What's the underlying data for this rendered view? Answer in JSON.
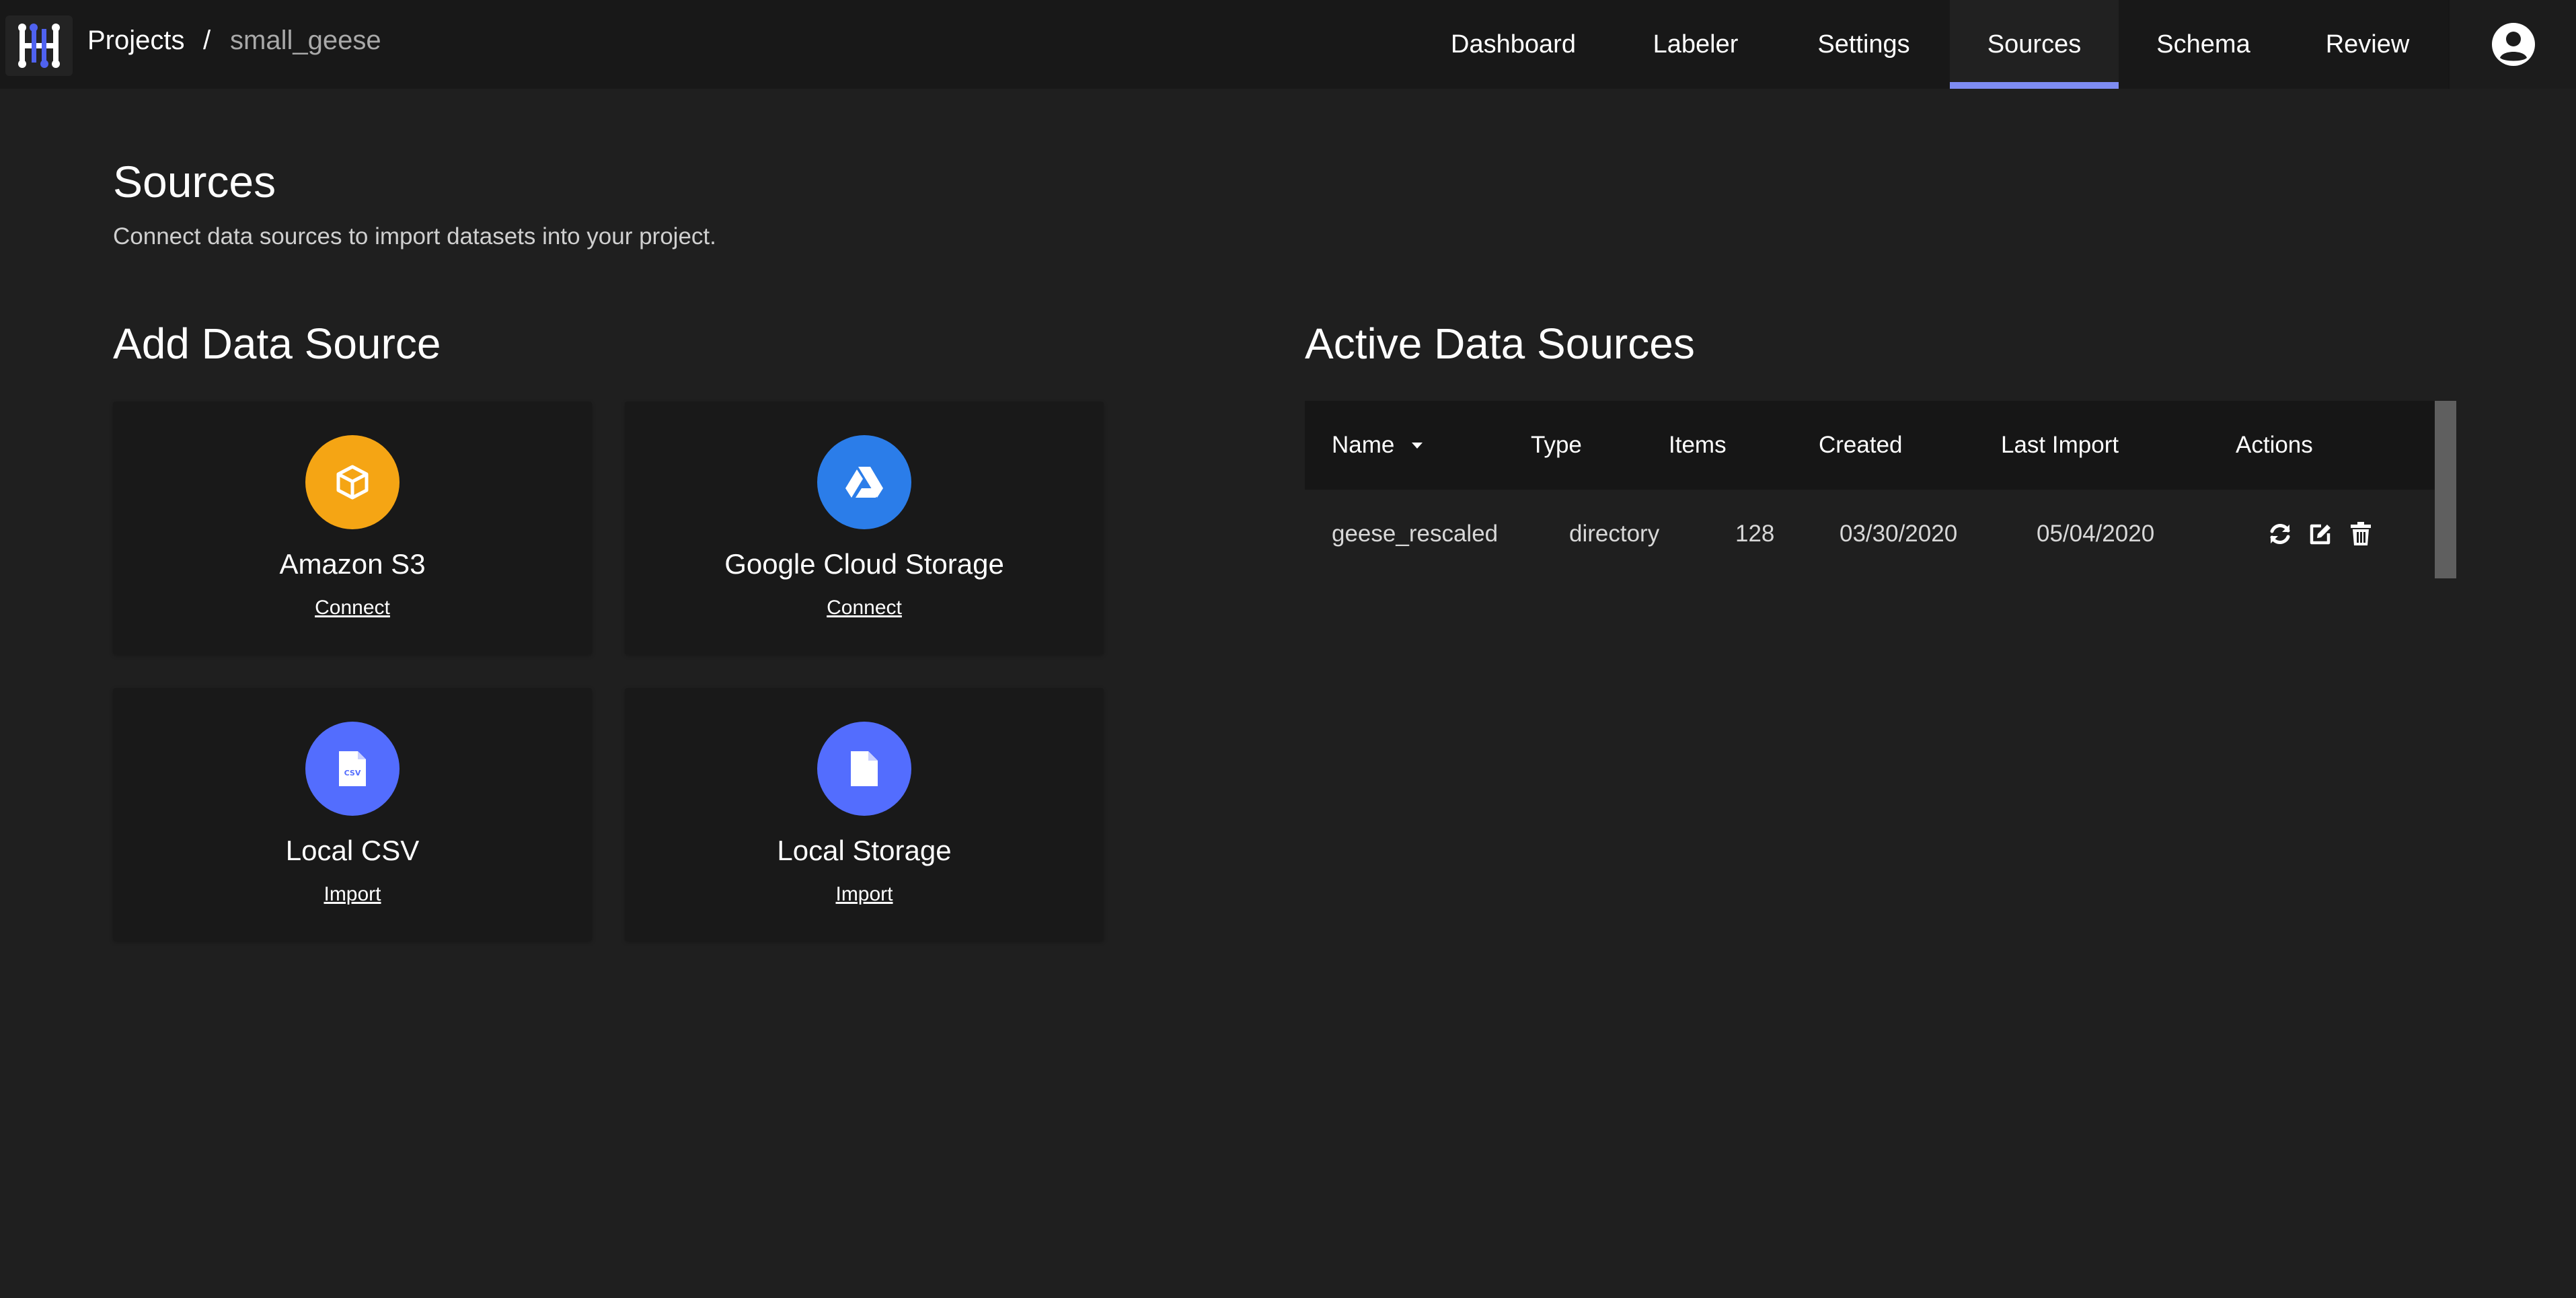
{
  "header": {
    "breadcrumb_root": "Projects",
    "breadcrumb_separator": "/",
    "project_name": "small_geese",
    "nav": [
      {
        "label": "Dashboard"
      },
      {
        "label": "Labeler"
      },
      {
        "label": "Settings"
      },
      {
        "label": "Sources"
      },
      {
        "label": "Schema"
      },
      {
        "label": "Review"
      }
    ],
    "active_tab": "Sources",
    "accent_color": "#7e8cf2"
  },
  "page": {
    "title": "Sources",
    "subtitle": "Connect data sources to import datasets into your project."
  },
  "add_section": {
    "title": "Add Data Source",
    "cards": [
      {
        "name": "Amazon S3",
        "action": "Connect",
        "icon": "cube-icon",
        "color": "#f5a514"
      },
      {
        "name": "Google Cloud Storage",
        "action": "Connect",
        "icon": "google-drive-icon",
        "color": "#2b7de9"
      },
      {
        "name": "Local CSV",
        "action": "Import",
        "icon": "csv-file-icon",
        "color": "#536dfe"
      },
      {
        "name": "Local Storage",
        "action": "Import",
        "icon": "file-icon",
        "color": "#536dfe"
      }
    ]
  },
  "active_section": {
    "title": "Active Data Sources",
    "columns": [
      "Name",
      "Type",
      "Items",
      "Created",
      "Last Import",
      "Actions"
    ],
    "sort_column": "Name",
    "rows": [
      {
        "name": "geese_rescaled",
        "type": "directory",
        "items": "128",
        "created": "03/30/2020",
        "last_import": "05/04/2020"
      }
    ],
    "row_actions": [
      "refresh-icon",
      "edit-icon",
      "trash-icon"
    ]
  }
}
